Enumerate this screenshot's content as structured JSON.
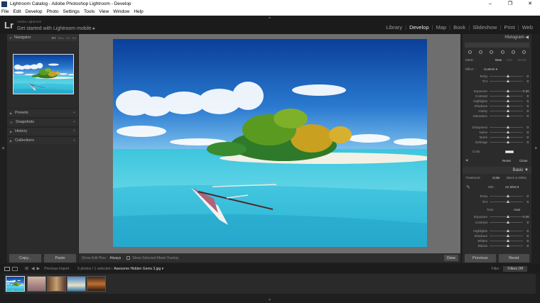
{
  "window": {
    "title": "Lightroom Catalog - Adobe Photoshop Lightroom - Develop",
    "controls": [
      "–",
      "❐",
      "✕"
    ]
  },
  "menu": [
    "File",
    "Edit",
    "Develop",
    "Photo",
    "Settings",
    "Tools",
    "View",
    "Window",
    "Help"
  ],
  "identity": {
    "logo": "Lr",
    "small": "Adobe Lightroom",
    "main": "Get started with Lightroom mobile ▸"
  },
  "modules": [
    "Library",
    "Develop",
    "Map",
    "Book",
    "Slideshow",
    "Print",
    "Web"
  ],
  "active_module": "Develop",
  "left_panel": {
    "navigator": "Navigator",
    "zoom_levels": [
      "FIT",
      "FILL",
      "1:1",
      "4:1"
    ],
    "sections": [
      "Presets",
      "Snapshots",
      "History",
      "Collections"
    ],
    "copy": "Copy...",
    "paste": "Paste"
  },
  "toolbar": {
    "show_edit_pins": "Show Edit Pins :",
    "pins_value": "Always",
    "show_overlay": "Show Selected Mask Overlay",
    "done": "Done"
  },
  "right_panel": {
    "histogram": "Histogram",
    "mask_label": "Mask :",
    "mask_options": [
      "New",
      "Edit",
      "Brush"
    ],
    "effect_label": "Effect :",
    "effect_value": "Custom ▾",
    "local_sliders": [
      {
        "label": "Temp",
        "value": "0"
      },
      {
        "label": "Tint",
        "value": "0"
      },
      {
        "label": "Exposure",
        "value": "0.00"
      },
      {
        "label": "Contrast",
        "value": "0"
      },
      {
        "label": "Highlights",
        "value": "0"
      },
      {
        "label": "Shadows",
        "value": "0"
      },
      {
        "label": "Clarity",
        "value": "0"
      },
      {
        "label": "Saturation",
        "value": "0"
      },
      {
        "label": "Sharpness",
        "value": "0"
      },
      {
        "label": "Noise",
        "value": "0"
      },
      {
        "label": "Moiré",
        "value": "0"
      },
      {
        "label": "Defringe",
        "value": "0"
      }
    ],
    "color_label": "Color",
    "reset": "Reset",
    "close": "Close",
    "basic": "Basic",
    "treatment_label": "Treatment :",
    "treatment_color": "Color",
    "treatment_bw": "Black & White",
    "wb_label": "WB :",
    "wb_value": "As Shot ▾",
    "basic_sliders_1": [
      {
        "label": "Temp",
        "value": "0"
      },
      {
        "label": "Tint",
        "value": "0"
      }
    ],
    "tone_label": "Tone",
    "tone_auto": "Auto",
    "basic_sliders_2": [
      {
        "label": "Exposure",
        "value": "0.00"
      },
      {
        "label": "Contrast",
        "value": "0"
      }
    ],
    "basic_sliders_3": [
      {
        "label": "Highlights",
        "value": "0"
      },
      {
        "label": "Shadows",
        "value": "0"
      },
      {
        "label": "Whites",
        "value": "0"
      },
      {
        "label": "Blacks",
        "value": "0"
      }
    ],
    "previous": "Previous",
    "reset_btn": "Reset"
  },
  "filmstrip_bar": {
    "previous_import": "Previous Import",
    "count": "5 photos / 1 selected /",
    "filename": "Awesome Hidden Gems 3.jpg ▾",
    "filter_label": "Filter :",
    "filter_value": "Filters Off"
  },
  "filmstrip_count": 5
}
